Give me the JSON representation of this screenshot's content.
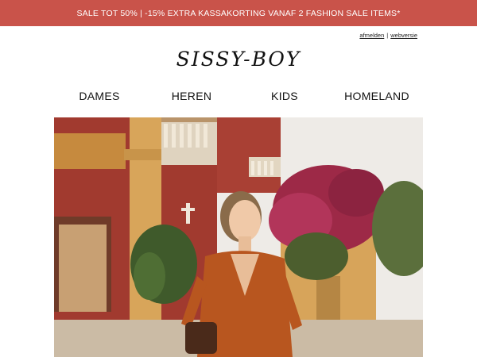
{
  "promo": {
    "text": "SALE TOT 50% | -15% EXTRA KASSAKORTING VANAF 2 FASHION SALE ITEMS*"
  },
  "utility": {
    "unsubscribe": "afmelden",
    "separator": "|",
    "webversion": "webversie"
  },
  "brand": {
    "logo_text": "SISSY-BOY"
  },
  "nav": {
    "items": [
      "DAMES",
      "HEREN",
      "KIDS",
      "HOMELAND"
    ]
  },
  "hero": {
    "alt": "woman in rust-orange dress in sunlit courtyard with red walls and bougainvillea"
  },
  "colors": {
    "promo_bg": "#c9534a",
    "text": "#111111",
    "wall_red": "#a03b30",
    "wall_ochre": "#d9a85a",
    "dress": "#b8561f"
  }
}
